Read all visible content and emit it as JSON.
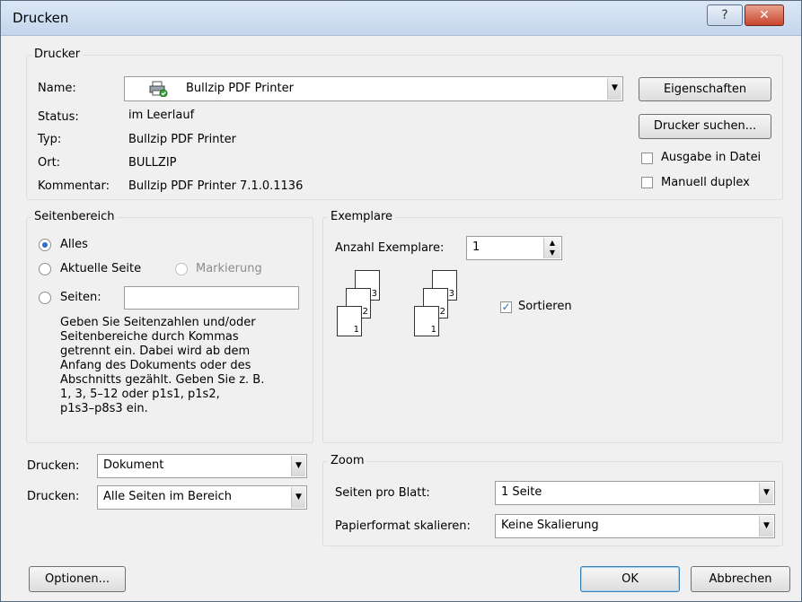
{
  "window": {
    "title": "Drucken",
    "help_glyph": "?",
    "close_glyph": "✕"
  },
  "printer": {
    "group_label": "Drucker",
    "name_label": "Name:",
    "name_value": "Bullzip PDF Printer",
    "status_label": "Status:",
    "status_value": "im Leerlauf",
    "type_label": "Typ:",
    "type_value": "Bullzip PDF Printer",
    "location_label": "Ort:",
    "location_value": "BULLZIP",
    "comment_label": "Kommentar:",
    "comment_value": "Bullzip PDF Printer 7.1.0.1136",
    "properties_button": "Eigenschaften",
    "find_printer_button": "Drucker suchen...",
    "print_to_file_label": "Ausgabe in Datei",
    "print_to_file_checked": false,
    "manual_duplex_label": "Manuell duplex",
    "manual_duplex_checked": false,
    "printer_icon": "printer-icon"
  },
  "page_range": {
    "group_label": "Seitenbereich",
    "all_label": "Alles",
    "all_selected": true,
    "current_page_label": "Aktuelle Seite",
    "selection_label": "Markierung",
    "pages_label": "Seiten:",
    "pages_value": "",
    "hint_lines": [
      "Geben Sie Seitenzahlen und/oder",
      "Seitenbereiche durch Kommas",
      "getrennt ein. Dabei wird ab dem",
      "Anfang des Dokuments oder des",
      "Abschnitts gezählt. Geben Sie z. B.",
      "1, 3, 5–12 oder p1s1, p1s2,",
      "p1s3–p8s3 ein."
    ]
  },
  "copies": {
    "group_label": "Exemplare",
    "count_label": "Anzahl Exemplare:",
    "count_value": "1",
    "collate_label": "Sortieren",
    "collate_checked": true,
    "page_numbers": [
      "3",
      "2",
      "1"
    ]
  },
  "print_what": {
    "label1": "Drucken:",
    "value1": "Dokument",
    "label2": "Drucken:",
    "value2": "Alle Seiten im Bereich"
  },
  "zoom": {
    "group_label": "Zoom",
    "pages_per_sheet_label": "Seiten pro Blatt:",
    "pages_per_sheet_value": "1 Seite",
    "scale_label": "Papierformat skalieren:",
    "scale_value": "Keine Skalierung"
  },
  "footer": {
    "options_button": "Optionen...",
    "ok_button": "OK",
    "cancel_button": "Abbrechen"
  },
  "colors": {
    "accent": "#2d6fc6",
    "frame": "#5a6b7d"
  }
}
